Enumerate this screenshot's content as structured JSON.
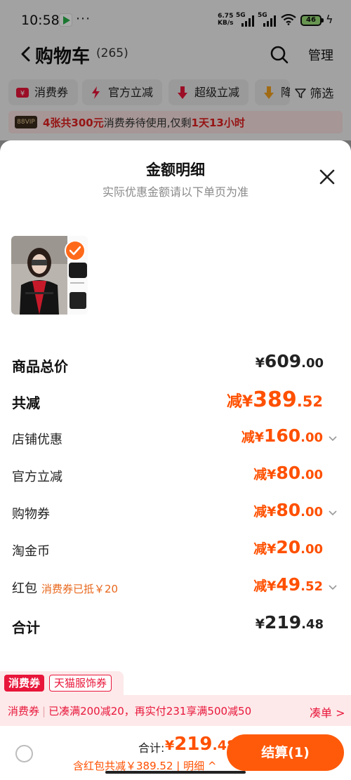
{
  "status_bar": {
    "time": "10:58",
    "dots": "···",
    "speed_value": "6.75",
    "speed_unit": "KB/s",
    "net1": "5G",
    "net2": "5G",
    "battery": "46"
  },
  "header": {
    "title": "购物车",
    "count": "(265)",
    "manage_label": "管理"
  },
  "filters": [
    {
      "label": "消费券"
    },
    {
      "label": "官方立减"
    },
    {
      "label": "超级立减"
    },
    {
      "label": "降"
    }
  ],
  "filter_button": "筛选",
  "vip_banner": {
    "badge": "88VIP",
    "part1": "4张共300元",
    "part2": "消费券待使用,仅剩",
    "part3": "1天13小时"
  },
  "sheet": {
    "title": "金额明细",
    "subtitle": "实际优惠金额请以下单页为准",
    "rows": [
      {
        "label": "商品总价",
        "prefix": "¥",
        "int": "609",
        "dec": ".00"
      },
      {
        "label": "共减",
        "prefix": "减¥",
        "int": "389",
        "dec": ".52"
      },
      {
        "label": "店铺优惠",
        "prefix": "减¥",
        "int": "160",
        "dec": ".00"
      },
      {
        "label": "官方立减",
        "prefix": "减¥",
        "int": "80",
        "dec": ".00"
      },
      {
        "label": "购物券",
        "prefix": "减¥",
        "int": "80",
        "dec": ".00"
      },
      {
        "label": "淘金币",
        "prefix": "减¥",
        "int": "20",
        "dec": ".00"
      },
      {
        "label": "红包",
        "note": "消费券已抵￥20",
        "prefix": "减¥",
        "int": "49",
        "dec": ".52"
      },
      {
        "label": "合计",
        "prefix": "¥",
        "int": "219",
        "dec": ".48"
      }
    ]
  },
  "tags": {
    "consume": "消费券",
    "tmall": "天猫服饰券"
  },
  "promo": {
    "tag": "消费券",
    "sep": "|",
    "text": "已凑满200减20，再实付231享满500减50",
    "link": "凑单 >"
  },
  "footer": {
    "total_label": "合计:",
    "total_prefix": "¥",
    "total_int": "219",
    "total_dec": ".48",
    "sub_text": "含红包共减￥389.52 | 明细 ^",
    "checkout_label": "结算(1)"
  },
  "colors": {
    "accent": "#ff5000",
    "promo_red": "#e8163a",
    "checkout": "#ff5a0a"
  }
}
